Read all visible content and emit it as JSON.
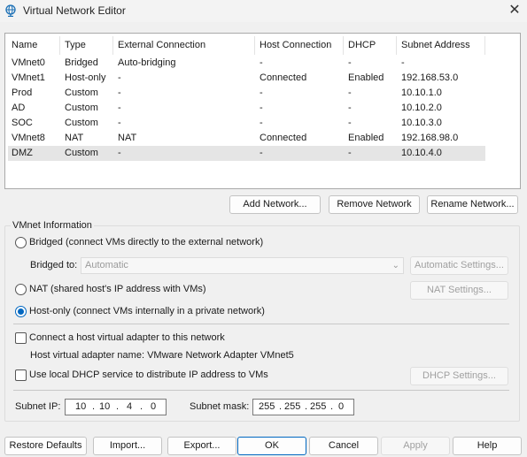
{
  "window": {
    "title": "Virtual Network Editor",
    "icon": "globe-icon",
    "close_glyph": "✕"
  },
  "table": {
    "headers": [
      "Name",
      "Type",
      "External Connection",
      "Host Connection",
      "DHCP",
      "Subnet Address"
    ],
    "rows": [
      {
        "name": "VMnet0",
        "type": "Bridged",
        "external": "Auto-bridging",
        "host": "-",
        "dhcp": "-",
        "subnet": "-"
      },
      {
        "name": "VMnet1",
        "type": "Host-only",
        "external": "-",
        "host": "Connected",
        "dhcp": "Enabled",
        "subnet": "192.168.53.0"
      },
      {
        "name": "Prod",
        "type": "Custom",
        "external": "-",
        "host": "-",
        "dhcp": "-",
        "subnet": "10.10.1.0"
      },
      {
        "name": "AD",
        "type": "Custom",
        "external": "-",
        "host": "-",
        "dhcp": "-",
        "subnet": "10.10.2.0"
      },
      {
        "name": "SOC",
        "type": "Custom",
        "external": "-",
        "host": "-",
        "dhcp": "-",
        "subnet": "10.10.3.0"
      },
      {
        "name": "VMnet8",
        "type": "NAT",
        "external": "NAT",
        "host": "Connected",
        "dhcp": "Enabled",
        "subnet": "192.168.98.0"
      },
      {
        "name": "DMZ",
        "type": "Custom",
        "external": "-",
        "host": "-",
        "dhcp": "-",
        "subnet": "10.10.4.0"
      }
    ],
    "selected_row": "DMZ"
  },
  "table_buttons": {
    "add": "Add Network...",
    "remove": "Remove Network",
    "rename": "Rename Network..."
  },
  "vmnet_info": {
    "group_label": "VMnet Information",
    "bridged_label": "Bridged (connect VMs directly to the external network)",
    "bridged_to_label": "Bridged to:",
    "bridged_to_value": "Automatic",
    "auto_settings": "Automatic Settings...",
    "nat_label": "NAT (shared host's IP address with VMs)",
    "nat_settings": "NAT Settings...",
    "hostonly_label": "Host-only (connect VMs internally in a private network)",
    "selected_mode": "Host-only",
    "connect_adapter_label": "Connect a host virtual adapter to this network",
    "connect_adapter_checked": false,
    "adapter_name_label": "Host virtual adapter name: VMware Network Adapter VMnet5",
    "dhcp_label": "Use local DHCP service to distribute IP address to VMs",
    "dhcp_checked": false,
    "dhcp_settings": "DHCP Settings...",
    "subnet_ip_label": "Subnet IP:",
    "subnet_ip": [
      "10",
      "10",
      "4",
      "0"
    ],
    "subnet_mask_label": "Subnet mask:",
    "subnet_mask": [
      "255",
      "255",
      "255",
      "0"
    ]
  },
  "footer": {
    "restore": "Restore Defaults",
    "import": "Import...",
    "export": "Export...",
    "ok": "OK",
    "cancel": "Cancel",
    "apply": "Apply",
    "help": "Help"
  },
  "colors": {
    "accent": "#0067c0",
    "selected_row": "#e5e5e5",
    "window_bg": "#f0f0f0"
  }
}
